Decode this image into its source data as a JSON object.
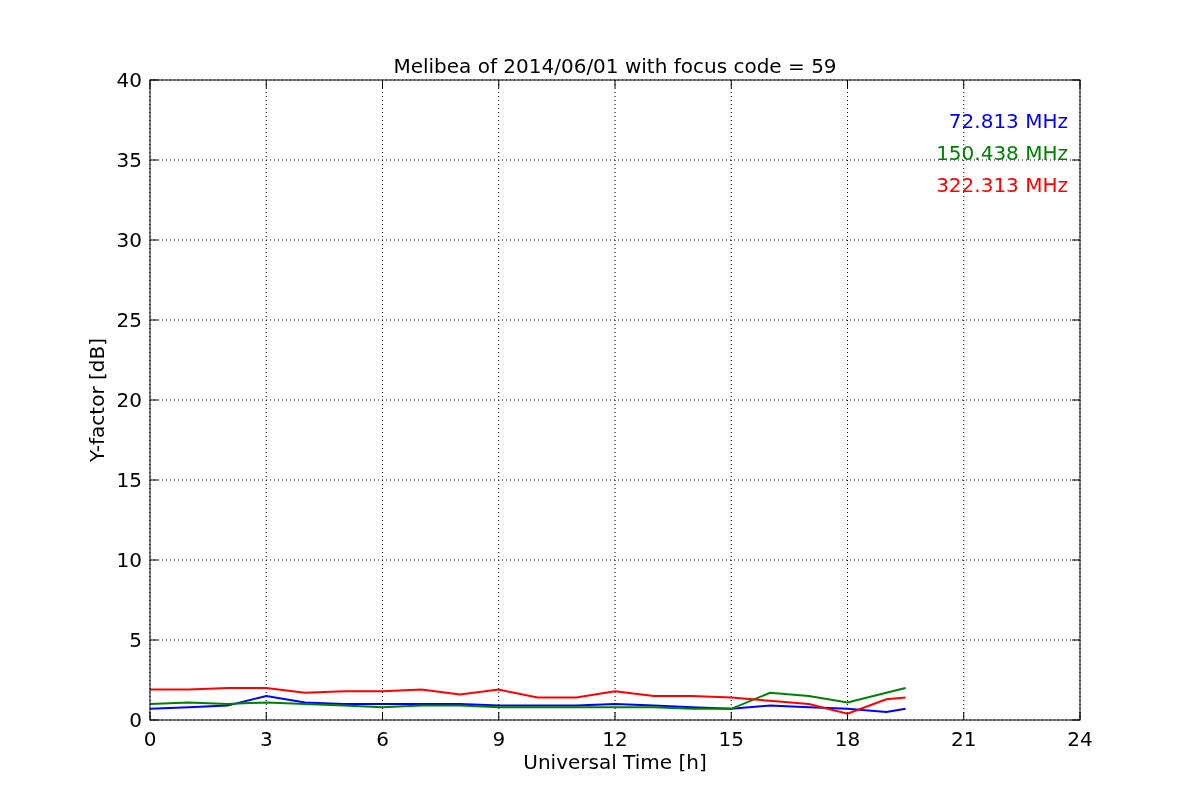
{
  "chart_data": {
    "type": "line",
    "title": "Melibea of 2014/06/01 with focus code = 59",
    "xlabel": "Universal Time [h]",
    "ylabel": "Y-factor [dB]",
    "x": [
      0,
      1,
      2,
      3,
      4,
      5,
      6,
      7,
      8,
      9,
      10,
      11,
      12,
      13,
      14,
      15,
      16,
      17,
      18,
      19,
      19.5
    ],
    "series": [
      {
        "name": "72.813 MHz",
        "color": "#0000ff",
        "values": [
          0.7,
          0.8,
          0.9,
          1.5,
          1.1,
          1.0,
          1.0,
          1.0,
          1.0,
          0.9,
          0.9,
          0.9,
          1.0,
          0.9,
          0.8,
          0.7,
          0.9,
          0.8,
          0.7,
          0.5,
          0.7
        ]
      },
      {
        "name": "150.438 MHz",
        "color": "#008000",
        "values": [
          1.0,
          1.1,
          1.0,
          1.1,
          1.0,
          0.9,
          0.8,
          0.9,
          0.9,
          0.8,
          0.8,
          0.8,
          0.8,
          0.8,
          0.7,
          0.7,
          1.7,
          1.5,
          1.1,
          1.7,
          2.0
        ]
      },
      {
        "name": "322.313 MHz",
        "color": "#ff0000",
        "values": [
          1.9,
          1.9,
          2.0,
          2.0,
          1.7,
          1.8,
          1.8,
          1.9,
          1.6,
          1.9,
          1.4,
          1.4,
          1.8,
          1.5,
          1.5,
          1.4,
          1.2,
          1.0,
          0.4,
          1.3,
          1.4
        ]
      }
    ],
    "grid": true,
    "xlim": [
      0,
      24
    ],
    "ylim": [
      0,
      40
    ],
    "xticks": [
      0,
      3,
      6,
      9,
      12,
      15,
      18,
      21,
      24
    ],
    "yticks": [
      0,
      5,
      10,
      15,
      20,
      25,
      30,
      35,
      40
    ]
  }
}
